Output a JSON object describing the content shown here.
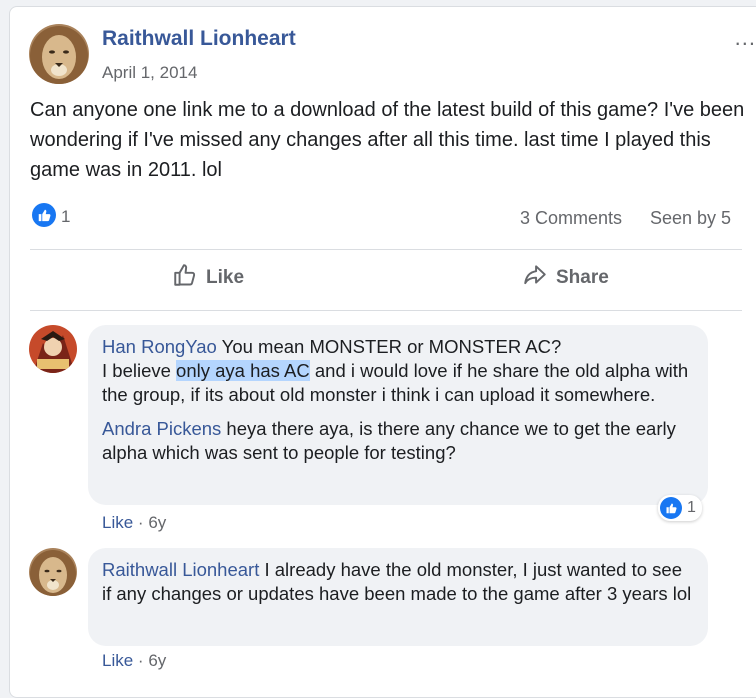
{
  "post": {
    "author": "Raithwall Lionheart",
    "date": "April 1, 2014",
    "text": "Can anyone one link me to a download of the latest build of this game? I've been wondering if I've missed any changes after all this time. last time I played this game was in 2011. lol",
    "like_count": "1",
    "comments_label": "3 Comments",
    "seen_label": "Seen by 5",
    "more_label": "...",
    "actions": {
      "like": "Like",
      "share": "Share"
    }
  },
  "comments": [
    {
      "author": "Han RongYao",
      "text_1": "You mean MONSTER or MONSTER AC?",
      "text_2a": "I believe ",
      "text_2_highlight": "only aya has AC",
      "text_2b": " and i would love if he share the old alpha with the group, if its about old monster i think i can upload it somewhere.",
      "mention": "Andra Pickens",
      "text_3": " heya there aya, is there any chance we to get the early alpha which was sent to people for testing?",
      "like_count": "1",
      "like_label": "Like",
      "age": "6y"
    },
    {
      "author": "Raithwall Lionheart",
      "text": " I already have the old monster, I just wanted to see if any changes or updates have been made to the game after 3 years lol",
      "like_label": "Like",
      "age": "6y"
    }
  ],
  "colors": {
    "link": "#385898",
    "accent": "#1877f2",
    "muted": "#65676b",
    "highlight": "#b4d5fe"
  },
  "icons": {
    "post_like_badge": "thumbs-up-icon",
    "like_action": "thumbs-up-outline-icon",
    "share_action": "share-arrow-icon"
  }
}
